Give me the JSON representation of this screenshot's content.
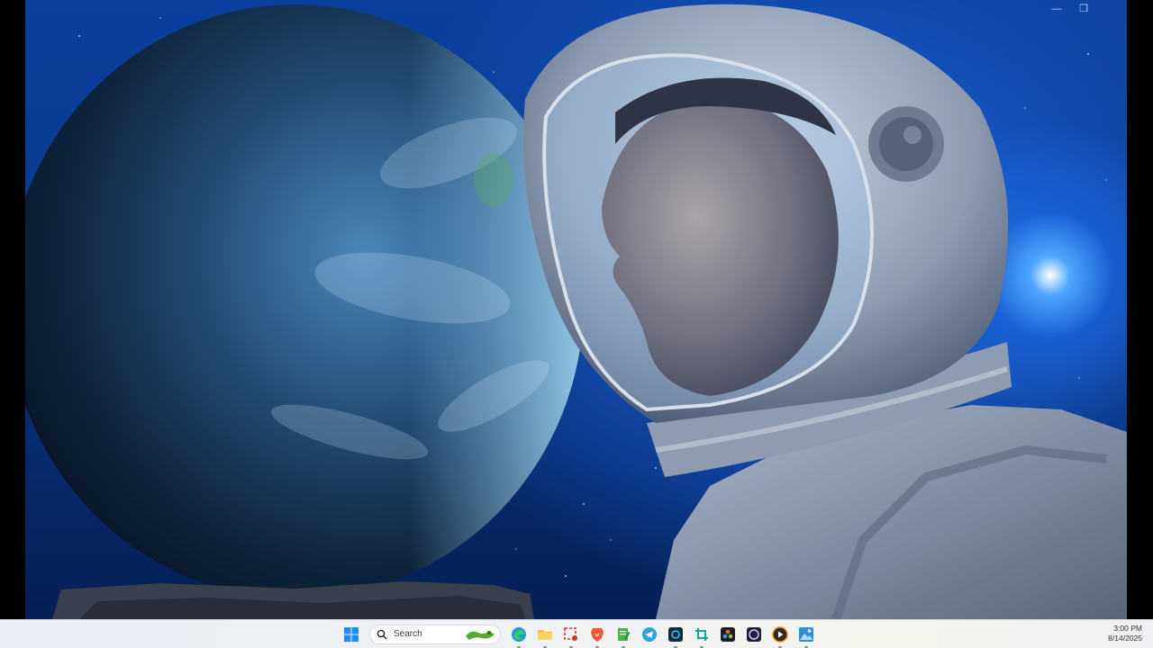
{
  "taskbar": {
    "search_label": "Search",
    "apps": [
      {
        "name": "start",
        "icon": "windows-logo-icon"
      },
      {
        "name": "edge",
        "icon": "edge-icon"
      },
      {
        "name": "file-explorer",
        "icon": "folder-icon"
      },
      {
        "name": "snipping-tool",
        "icon": "snipping-tool-icon"
      },
      {
        "name": "brave",
        "icon": "brave-lion-icon"
      },
      {
        "name": "notepad",
        "icon": "notepad-icon"
      },
      {
        "name": "telegram",
        "icon": "telegram-icon"
      },
      {
        "name": "camera-app",
        "icon": "camera-icon"
      },
      {
        "name": "capture-app",
        "icon": "crop-icon"
      },
      {
        "name": "davinci-resolve",
        "icon": "resolve-icon"
      },
      {
        "name": "obs",
        "icon": "obs-icon"
      },
      {
        "name": "media-player",
        "icon": "play-icon"
      },
      {
        "name": "photos",
        "icon": "photos-icon"
      }
    ],
    "clock": {
      "time": "3:00 PM",
      "date": "8/14/2025"
    }
  },
  "window": {
    "controls": {
      "minimize": "—",
      "restore": "❐"
    }
  },
  "colors": {
    "sky_accent": "#1f6fe0",
    "taskbar_bg": "#eef1f5"
  }
}
